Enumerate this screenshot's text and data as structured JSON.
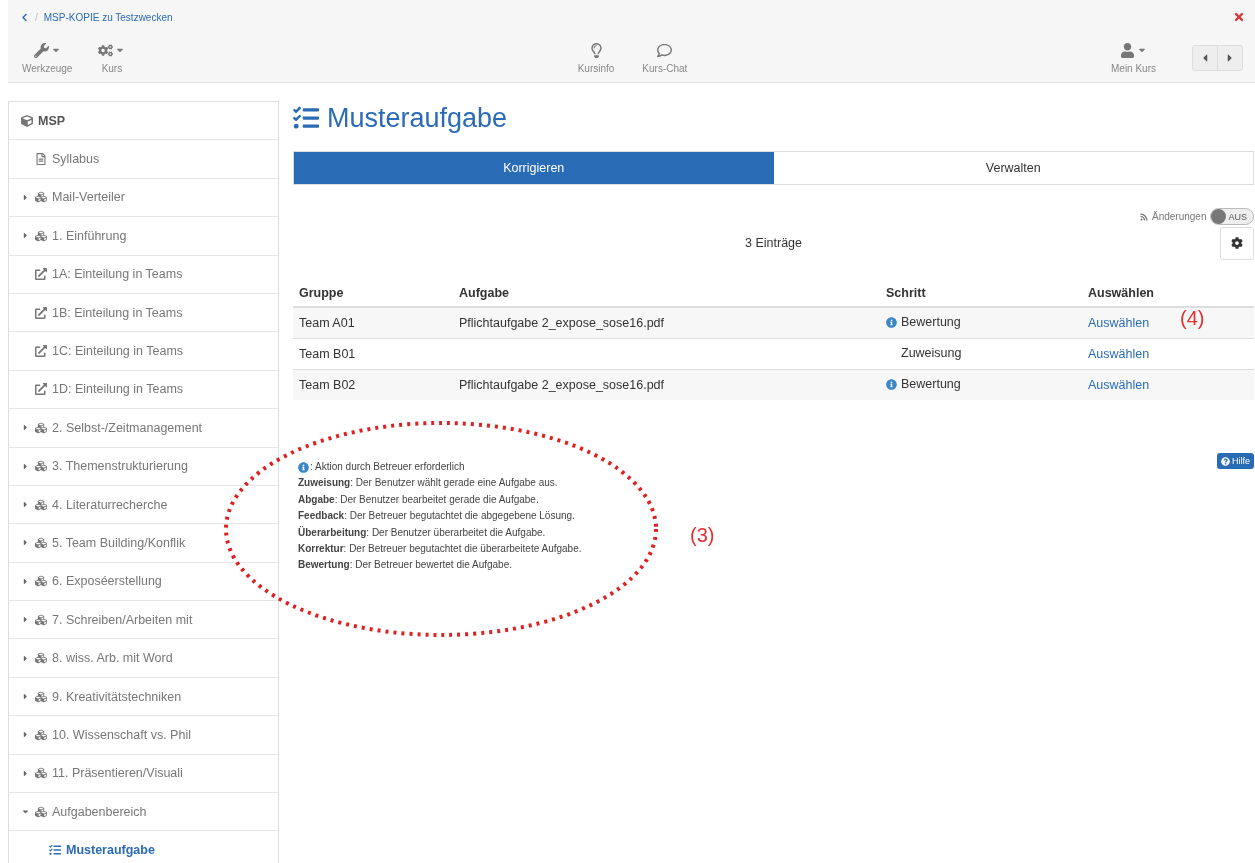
{
  "breadcrumb": {
    "separator": "/",
    "label": "MSP-KOPIE zu Testzwecken"
  },
  "toolbar": {
    "left": [
      {
        "kind": "tools",
        "label": "Werkzeuge"
      },
      {
        "kind": "course",
        "label": "Kurs"
      }
    ],
    "center": [
      {
        "kind": "info",
        "label": "Kursinfo"
      },
      {
        "kind": "chat",
        "label": "Kurs-Chat"
      }
    ],
    "right": [
      {
        "kind": "user",
        "label": "Mein Kurs"
      }
    ]
  },
  "sidebar": {
    "root": {
      "label": "MSP"
    },
    "items": [
      {
        "kind": "page",
        "label": "Syllabus",
        "selected": false
      },
      {
        "kind": "folder",
        "label": "Mail-Verteiler",
        "expanded": false,
        "selected": false
      },
      {
        "kind": "folder",
        "label": "1. Einführung",
        "expanded": false,
        "selected": false
      },
      {
        "kind": "link",
        "label": "1A: Einteilung in Teams",
        "selected": false
      },
      {
        "kind": "link",
        "label": "1B: Einteilung in Teams",
        "selected": false
      },
      {
        "kind": "link",
        "label": "1C: Einteilung in Teams",
        "selected": false
      },
      {
        "kind": "link",
        "label": "1D: Einteilung in Teams",
        "selected": false
      },
      {
        "kind": "folder",
        "label": "2. Selbst-/Zeitmanagement",
        "expanded": false,
        "selected": false
      },
      {
        "kind": "folder",
        "label": "3. Themenstrukturierung",
        "expanded": false,
        "selected": false
      },
      {
        "kind": "folder",
        "label": "4. Literaturrecherche",
        "expanded": false,
        "selected": false
      },
      {
        "kind": "folder",
        "label": "5. Team Building/Konflik",
        "expanded": false,
        "selected": false
      },
      {
        "kind": "folder",
        "label": "6. Exposéerstellung",
        "expanded": false,
        "selected": false
      },
      {
        "kind": "folder",
        "label": "7. Schreiben/Arbeiten mit",
        "expanded": false,
        "selected": false
      },
      {
        "kind": "folder",
        "label": "8. wiss. Arb. mit Word",
        "expanded": false,
        "selected": false
      },
      {
        "kind": "folder",
        "label": "9. Kreativitätstechniken",
        "expanded": false,
        "selected": false
      },
      {
        "kind": "folder",
        "label": "10. Wissenschaft vs. Phil",
        "expanded": false,
        "selected": false
      },
      {
        "kind": "folder",
        "label": "11. Präsentieren/Visuali",
        "expanded": false,
        "selected": false
      },
      {
        "kind": "folder",
        "label": "Aufgabenbereich",
        "expanded": true,
        "selected": false,
        "children": [
          {
            "kind": "task",
            "label": "Musteraufgabe",
            "selected": true
          }
        ]
      }
    ]
  },
  "page": {
    "title": "Musteraufgabe",
    "tabs": [
      {
        "label": "Korrigieren",
        "selected": true
      },
      {
        "label": "Verwalten",
        "selected": false
      }
    ],
    "changes_toggle": {
      "label": "Änderungen",
      "state": "AUS",
      "on": false
    },
    "entries": "3 Einträge",
    "table": {
      "columns": [
        "Gruppe",
        "Aufgabe",
        "Schritt",
        "Auswählen"
      ],
      "rows": [
        {
          "group": "Team A01",
          "task": "Pflichtaufgabe 2_expose_sose16.pdf",
          "step": "Bewertung",
          "action_required": true,
          "action": "Auswählen"
        },
        {
          "group": "Team B01",
          "step": "Zuweisung",
          "action_required": false,
          "action": "Auswählen"
        },
        {
          "group": "Team B02",
          "task": "Pflichtaufgabe 2_expose_sose16.pdf",
          "step": "Bewertung",
          "action_required": true,
          "action": "Auswählen"
        }
      ]
    },
    "legend": {
      "note": ": Aktion durch Betreuer erforderlich",
      "lines": [
        "**Zuweisung**: Der Benutzer wählt gerade eine Aufgabe aus.",
        "**Abgabe**: Der Benutzer bearbeitet gerade die Aufgabe.",
        "**Feedback**: Der Betreuer begutachtet die abgegebene Lösung.",
        "**Überarbeitung**: Der Benutzer überarbeitet die Aufgabe.",
        "**Korrektur**: Der Betreuer begutachtet die überarbeitete Aufgabe.",
        "**Bewertung**: Der Betreuer bewertet die Aufgabe."
      ]
    },
    "help_button": "Hilfe"
  },
  "annotations": [
    {
      "kind": "ellipse"
    },
    {
      "kind": "number",
      "text": "(3)"
    },
    {
      "kind": "number",
      "text": "(4)"
    }
  ]
}
